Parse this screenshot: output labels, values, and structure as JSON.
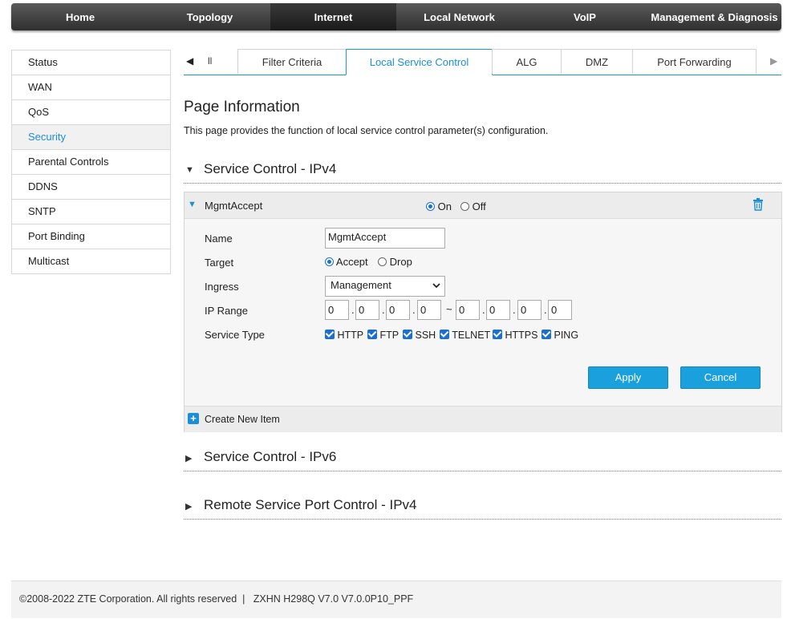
{
  "nav": [
    "Home",
    "Topology",
    "Internet",
    "Local Network",
    "VoIP",
    "Management & Diagnosis"
  ],
  "nav_active": "Internet",
  "sidebar": [
    "Status",
    "WAN",
    "QoS",
    "Security",
    "Parental Controls",
    "DDNS",
    "SNTP",
    "Port Binding",
    "Multicast"
  ],
  "sidebar_active": "Security",
  "tabs": {
    "prev_arrow": "◀",
    "partial": "ll",
    "items": [
      "Filter Criteria",
      "Local Service Control",
      "ALG",
      "DMZ",
      "Port Forwarding"
    ],
    "next_arrow": "▶"
  },
  "page_info": {
    "title": "Page Information",
    "desc": "This page provides the function of local service control parameter(s) configuration."
  },
  "sections": {
    "ipv4": "Service Control - IPv4",
    "ipv6": "Service Control - IPv6",
    "remote": "Remote Service Port Control - IPv4"
  },
  "rule": {
    "header_name": "MgmtAccept",
    "on_label": "On",
    "off_label": "Off",
    "enabled": true,
    "labels": {
      "name": "Name",
      "target": "Target",
      "ingress": "Ingress",
      "ip_range": "IP Range",
      "service_type": "Service Type"
    },
    "name_value": "MgmtAccept",
    "target_accept": "Accept",
    "target_drop": "Drop",
    "ingress_value": "Management",
    "ip_start": [
      "0",
      "0",
      "0",
      "0"
    ],
    "ip_end": [
      "0",
      "0",
      "0",
      "0"
    ],
    "range_sep": "~",
    "services": [
      "HTTP",
      "FTP",
      "SSH",
      "TELNET",
      "HTTPS",
      "PING"
    ],
    "apply": "Apply",
    "cancel": "Cancel",
    "create_new": "Create New Item"
  },
  "footer": "©2008-2022 ZTE Corporation. All rights reserved  |   ZXHN H298Q V7.0 V7.0.0P10_PPF",
  "colors": {
    "accent": "#1a8fd8",
    "button": "#1aa0dc"
  }
}
